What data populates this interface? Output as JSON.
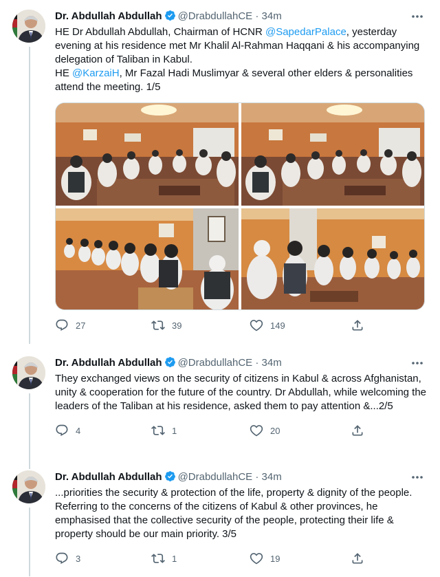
{
  "tweets": [
    {
      "name": "Dr. Abdullah Abdullah",
      "handle": "@DrabdullahCE",
      "dot": "·",
      "time": "34m",
      "text": [
        {
          "t": "HE Dr Abdullah Abdullah, Chairman of HCNR ",
          "link": false
        },
        {
          "t": "@SapedarPalace",
          "link": true
        },
        {
          "t": ", yesterday evening at his residence met Mr Khalil Al-Rahman Haqqani & his accompanying delegation of Taliban in Kabul.",
          "link": false
        },
        {
          "t": "\nHE ",
          "link": false
        },
        {
          "t": "@KarzaiH",
          "link": true
        },
        {
          "t": ", Mr Fazal Hadi Muslimyar & several other elders & personalities attend the meeting. 1/5",
          "link": false
        }
      ],
      "has_media": true,
      "replies": "27",
      "retweets": "39",
      "likes": "149"
    },
    {
      "name": "Dr. Abdullah Abdullah",
      "handle": "@DrabdullahCE",
      "dot": "·",
      "time": "34m",
      "text": [
        {
          "t": "They exchanged views on the security of citizens in Kabul & across Afghanistan, unity & cooperation for the future of the country. Dr Abdullah, while welcoming the leaders of the Taliban at his residence, asked them to pay attention &...2/5",
          "link": false
        }
      ],
      "has_media": false,
      "replies": "4",
      "retweets": "1",
      "likes": "20"
    },
    {
      "name": "Dr. Abdullah Abdullah",
      "handle": "@DrabdullahCE",
      "dot": "·",
      "time": "34m",
      "text": [
        {
          "t": "...priorities the security & protection of the life, property & dignity of the people. Referring to the concerns of the citizens of Kabul & other provinces, he emphasised that the collective security of the people, protecting their life & property should be our main priority. 3/5",
          "link": false
        }
      ],
      "has_media": false,
      "replies": "3",
      "retweets": "1",
      "likes": "19"
    }
  ],
  "colors": {
    "link": "#1d9bf0",
    "verified": "#1d9bf0",
    "secondary_text": "#536471",
    "thread_line": "#cfd9de"
  },
  "icons": [
    "verified-badge-icon",
    "more-icon",
    "reply-icon",
    "retweet-icon",
    "like-icon",
    "share-icon"
  ]
}
